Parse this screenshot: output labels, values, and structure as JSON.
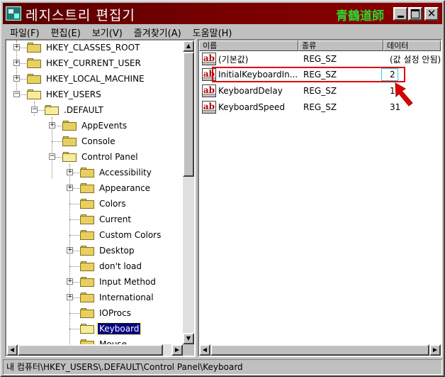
{
  "window": {
    "title": "레지스트리 편집기",
    "watermark": "青鶴道師"
  },
  "menu": [
    "파일(F)",
    "편집(E)",
    "보기(V)",
    "즐겨찾기(A)",
    "도움말(H)"
  ],
  "tree": [
    {
      "label": "HKEY_CLASSES_ROOT",
      "expander": "+"
    },
    {
      "label": "HKEY_CURRENT_USER",
      "expander": "+"
    },
    {
      "label": "HKEY_LOCAL_MACHINE",
      "expander": "+"
    },
    {
      "label": "HKEY_USERS",
      "expander": "−"
    },
    {
      "label": ".DEFAULT",
      "expander": "−"
    },
    {
      "label": "AppEvents",
      "expander": "+"
    },
    {
      "label": "Console",
      "expander": ""
    },
    {
      "label": "Control Panel",
      "expander": "−"
    },
    {
      "label": "Accessibility",
      "expander": "+"
    },
    {
      "label": "Appearance",
      "expander": "+"
    },
    {
      "label": "Colors",
      "expander": ""
    },
    {
      "label": "Current",
      "expander": ""
    },
    {
      "label": "Custom Colors",
      "expander": ""
    },
    {
      "label": "Desktop",
      "expander": "+"
    },
    {
      "label": "don't load",
      "expander": ""
    },
    {
      "label": "Input Method",
      "expander": "+"
    },
    {
      "label": "International",
      "expander": "+"
    },
    {
      "label": "IOProcs",
      "expander": ""
    },
    {
      "label": "Keyboard",
      "expander": "",
      "selected": true
    },
    {
      "label": "Mouse",
      "expander": ""
    }
  ],
  "list": {
    "columns": [
      "이름",
      "종류",
      "데이터"
    ],
    "rows": [
      {
        "name": "(기본값)",
        "type": "REG_SZ",
        "data": "(값 설정 안됨)"
      },
      {
        "name": "InitialKeyboardIn...",
        "type": "REG_SZ",
        "data": "2"
      },
      {
        "name": "KeyboardDelay",
        "type": "REG_SZ",
        "data": "1"
      },
      {
        "name": "KeyboardSpeed",
        "type": "REG_SZ",
        "data": "31"
      }
    ]
  },
  "status": "내 컴퓨터\\HKEY_USERS\\.DEFAULT\\Control Panel\\Keyboard",
  "icons": {
    "string_value": "ab",
    "expand": "+",
    "collapse": "−",
    "close": "✕"
  },
  "colors": {
    "title_bar": "#7a0000",
    "watermark": "#2fd22f",
    "highlight": "#e00000",
    "selection": "#000080"
  }
}
